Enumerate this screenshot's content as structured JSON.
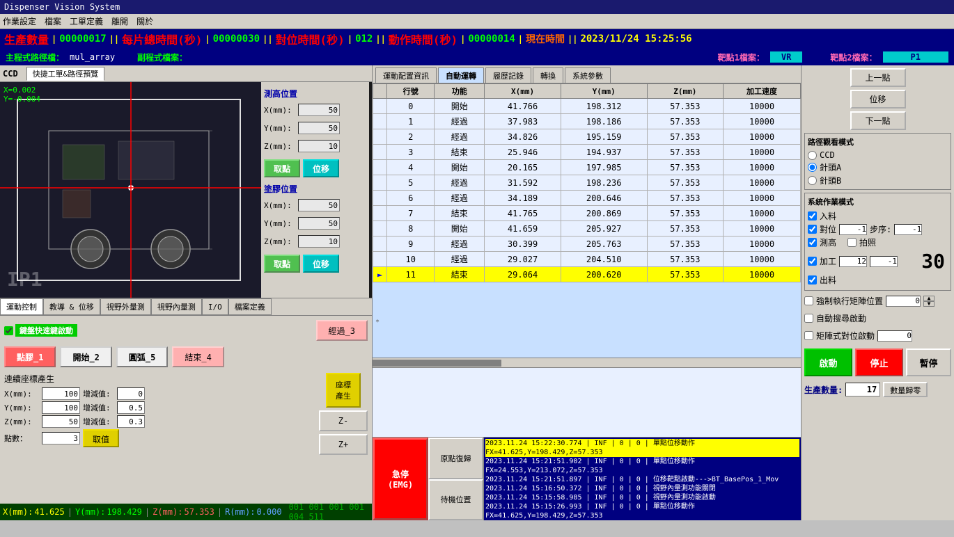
{
  "titleBar": {
    "title": "Dispenser Vision System"
  },
  "menuBar": {
    "items": [
      "作業設定",
      "檔案",
      "工單定義",
      "離開",
      "關於"
    ]
  },
  "statusTop": {
    "prod_label": "生產數量",
    "prod_value": "00000017",
    "total_time_label": "每片總時間(秒)",
    "total_time_value": "00000030",
    "align_time_label": "對位時間(秒)",
    "align_time_value": "012",
    "motion_time_label": "動作時間(秒)",
    "motion_time_value": "00000014",
    "current_time_label": "現在時間",
    "current_time_value": "2023/11/24  15:25:56"
  },
  "progBar": {
    "main_label": "主程式路徑檔：",
    "main_value": "mul_array",
    "sub_label": "副程式檔案：",
    "target1_label": "靶點1檔案：",
    "target1_value": "VR",
    "target2_label": "靶點2檔案：",
    "target2_value": "P1"
  },
  "ccd": {
    "label": "CCD",
    "tab": "快捷工單&路徑預覽",
    "coords": "X=0.002\nY=-0.004",
    "watermark": "IP1",
    "measurePos": {
      "label": "測高位置",
      "x_label": "X(mm):",
      "x_value": "50",
      "y_label": "Y(mm):",
      "y_value": "50",
      "z_label": "Z(mm):",
      "z_value": "10",
      "btn_get": "取點",
      "btn_move": "位移"
    },
    "applyPos": {
      "label": "塗膠位置",
      "x_label": "X(mm):",
      "x_value": "50",
      "y_label": "Y(mm):",
      "y_value": "50",
      "z_label": "Z(mm):",
      "z_value": "10",
      "btn_get": "取點",
      "btn_move": "位移"
    }
  },
  "motionTabs": {
    "tabs": [
      "運動控制",
      "教導 & 位移",
      "視野外量測",
      "視野內量測",
      "I/O",
      "檔案定義"
    ]
  },
  "motionControl": {
    "keyboard_label": "鍵盤快速鍵啟動",
    "btn_pass3": "經過_3",
    "btn_dot1": "點膠_1",
    "btn_start2": "開始_2",
    "btn_arc5": "圓弧_5",
    "btn_end4": "結束_4",
    "coord_gen_title": "連續座標產生",
    "x_label": "X(mm):",
    "x_value": "100",
    "x_inc_label": "增減值:",
    "x_inc_value": "0",
    "y_label": "Y(mm):",
    "y_value": "100",
    "y_inc_label": "增減值:",
    "y_inc_value": "0.5",
    "z_label": "Z(mm):",
    "z_value": "50",
    "z_inc_label": "增減值:",
    "z_inc_value": "0.3",
    "count_label": "點數：",
    "count_value": "3",
    "btn_getval": "取值",
    "btn_gen": "座標\n產生",
    "btn_zminus": "Z-",
    "btn_zplus": "Z+"
  },
  "dataTable": {
    "tabs": [
      "運動配置資訊",
      "自動運轉",
      "履歷記錄",
      "轉換",
      "系統參數"
    ],
    "activeTab": "自動運轉",
    "headers": [
      "行號",
      "功能",
      "X(mm)",
      "Y(mm)",
      "Z(mm)",
      "加工速度"
    ],
    "rows": [
      {
        "row": "0",
        "func": "開始",
        "x": "41.766",
        "y": "198.312",
        "z": "57.353",
        "speed": "10000"
      },
      {
        "row": "1",
        "func": "經過",
        "x": "37.983",
        "y": "198.186",
        "z": "57.353",
        "speed": "10000"
      },
      {
        "row": "2",
        "func": "經過",
        "x": "34.826",
        "y": "195.159",
        "z": "57.353",
        "speed": "10000"
      },
      {
        "row": "3",
        "func": "結束",
        "x": "25.946",
        "y": "194.937",
        "z": "57.353",
        "speed": "10000"
      },
      {
        "row": "4",
        "func": "開始",
        "x": "20.165",
        "y": "197.985",
        "z": "57.353",
        "speed": "10000"
      },
      {
        "row": "5",
        "func": "經過",
        "x": "31.592",
        "y": "198.236",
        "z": "57.353",
        "speed": "10000"
      },
      {
        "row": "6",
        "func": "經過",
        "x": "34.189",
        "y": "200.646",
        "z": "57.353",
        "speed": "10000"
      },
      {
        "row": "7",
        "func": "結束",
        "x": "41.765",
        "y": "200.869",
        "z": "57.353",
        "speed": "10000"
      },
      {
        "row": "8",
        "func": "開始",
        "x": "41.659",
        "y": "205.927",
        "z": "57.353",
        "speed": "10000"
      },
      {
        "row": "9",
        "func": "經過",
        "x": "30.399",
        "y": "205.763",
        "z": "57.353",
        "speed": "10000"
      },
      {
        "row": "10",
        "func": "經過",
        "x": "29.027",
        "y": "204.510",
        "z": "57.353",
        "speed": "10000"
      },
      {
        "row": "11",
        "func": "結束",
        "x": "29.064",
        "y": "200.620",
        "z": "57.353",
        "speed": "10000"
      }
    ],
    "highlighted_row": 11
  },
  "farRight": {
    "btn_prev": "上一點",
    "btn_move": "位移",
    "btn_next": "下一點",
    "path_mode_title": "路徑觀看模式",
    "path_options": [
      "CCD",
      "針頭A",
      "針頭B"
    ],
    "selected_path": "針頭A",
    "sys_mode_title": "系統作業模式",
    "checks": {
      "input": {
        "label": "入料",
        "checked": true
      },
      "align": {
        "label": "對位",
        "checked": true,
        "value": "-1",
        "step_label": "步序:",
        "step_value": "-1"
      },
      "measure": {
        "label": "測高",
        "checked": true
      },
      "photo": {
        "label": "拍照",
        "checked": false
      },
      "process": {
        "label": "加工",
        "checked": true,
        "val1": "12",
        "val2": "-1"
      },
      "output": {
        "label": "出料",
        "checked": true
      }
    },
    "big_number": "30",
    "force_label": "強制執行矩陣位置",
    "force_value": "0",
    "auto_search_label": "自動搜尋啟動",
    "matrix_align_label": "矩陣式對位啟動",
    "matrix_align_value": "0",
    "btn_start": "啟動",
    "btn_stop": "停止",
    "btn_pause": "暫停",
    "prod_count_label": "生產數量:",
    "prod_count_value": "17",
    "btn_reset": "數量歸零"
  },
  "bottomSection": {
    "emergency_line1": "急停",
    "emergency_line2": "(EMG)",
    "btn_recovery": "原點復歸",
    "btn_standby": "待機位置",
    "logs": [
      {
        "text": "2023.11.24 15:22:30.774 | INF | 0 | 0 |  單點位移動作FX=41.625,Y=198.429,Z=57.353",
        "highlight": true
      },
      {
        "text": "2023.11.24 15:21:51.902 | INF | 0 | 0 |  單點位移動作FX=24.553,Y=213.072,Z=57.353",
        "highlight": false
      },
      {
        "text": "2023.11.24 15:21:51.897 | INF | 0 | 0 |  位移靶點啟動--->BT_BasePos_1_Mov",
        "highlight": false
      },
      {
        "text": "2023.11.24 15:16:50.372 | INF | 0 | 0 |  視野內量測功能關閉",
        "highlight": false
      },
      {
        "text": "2023.11.24 15:15:58.985 | INF | 0 | 0 |  視野內量測功能啟動",
        "highlight": false
      },
      {
        "text": "2023.11.24 15:15:26.993 | INF | 0 | 0 |  單點位移動作FX=41.625,Y=198.429,Z=57.353",
        "highlight": false
      }
    ]
  },
  "statusBottom": {
    "x_label": "X(mm):",
    "x_value": "41.625",
    "y_label": "Y(mm):",
    "y_value": "198.429",
    "z_label": "Z(mm):",
    "z_value": "57.353",
    "r_label": "R(mm):",
    "r_value": "0.000",
    "extra": "001 001 001 001 004 511"
  }
}
